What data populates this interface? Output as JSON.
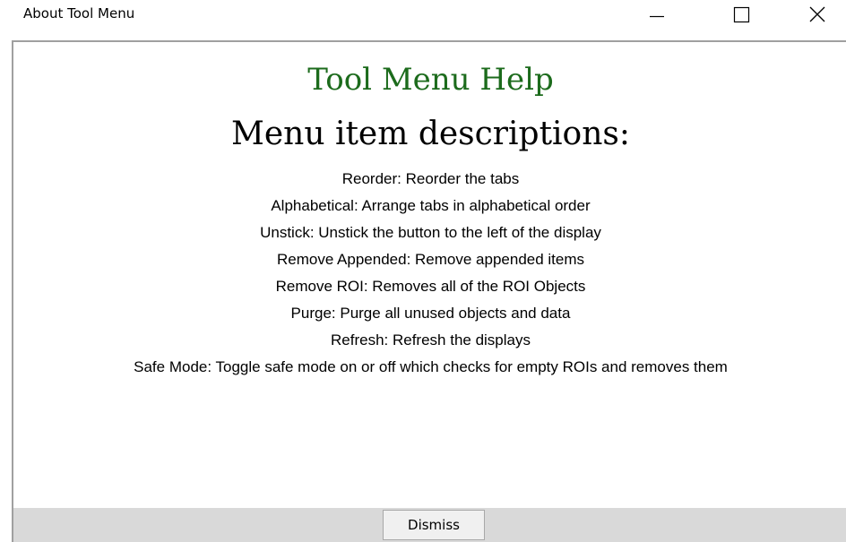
{
  "window": {
    "title": "About Tool Menu",
    "controls": {
      "minimize_icon": "minimize-icon",
      "maximize_icon": "maximize-icon",
      "close_icon": "close-icon"
    }
  },
  "help": {
    "title": "Tool Menu Help",
    "subtitle": "Menu item descriptions:",
    "items": [
      "Reorder: Reorder the tabs",
      "Alphabetical: Arrange tabs in alphabetical order",
      "Unstick: Unstick the button to the left of the display",
      "Remove Appended: Remove appended items",
      "Remove ROI: Removes all of the ROI Objects",
      "Purge: Purge all unused objects and data",
      "Refresh: Refresh the displays",
      "Safe Mode: Toggle safe mode on or off which checks for empty ROIs and removes them"
    ]
  },
  "footer": {
    "dismiss_label": "Dismiss"
  },
  "colors": {
    "title_green": "#1c6b1c",
    "footer_bg": "#d9d9d9"
  }
}
